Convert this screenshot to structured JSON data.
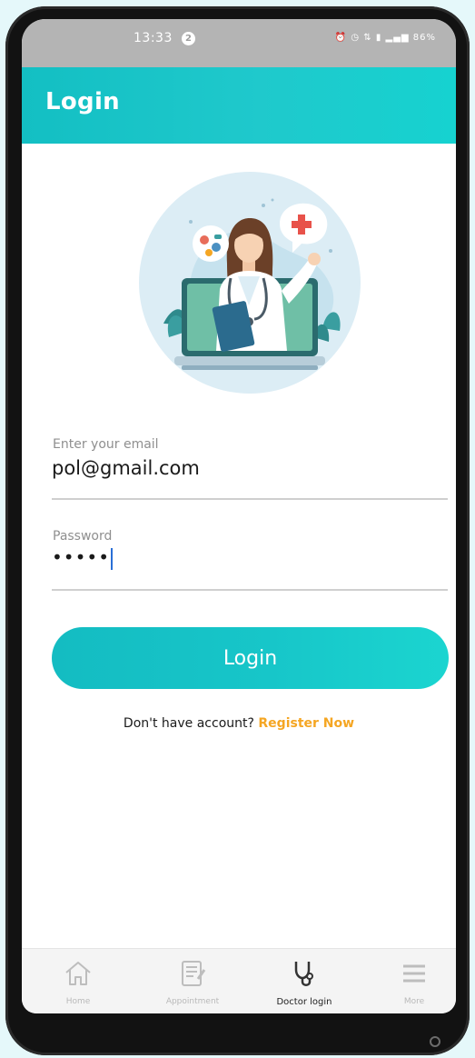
{
  "status_bar": {
    "time": "13:33",
    "notification_count": "2",
    "indicators": "⏰ ◷ ⇅ ▮ ▂▄▆ 86%"
  },
  "app_bar": {
    "title": "Login"
  },
  "form": {
    "email_label": "Enter your email",
    "email_value": "pol@gmail.com",
    "password_label": "Password",
    "password_value": "•••••",
    "login_button": "Login"
  },
  "register": {
    "prompt": "Don't have account?",
    "link": "Register Now"
  },
  "bottom_nav": {
    "items": [
      {
        "label": "Home",
        "icon": "home-icon"
      },
      {
        "label": "Appointment",
        "icon": "clipboard-icon"
      },
      {
        "label": "Doctor login",
        "icon": "stethoscope-icon"
      },
      {
        "label": "More",
        "icon": "menu-icon"
      }
    ],
    "active_index": 2
  },
  "colors": {
    "accent_teal": "#17c3c6",
    "register_link": "#f5a623",
    "status_bar": "#b4b4b4"
  }
}
